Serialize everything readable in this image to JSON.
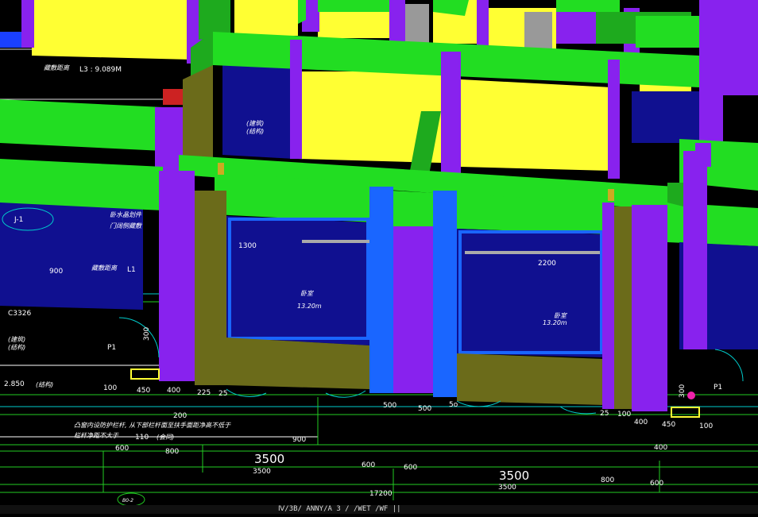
{
  "labels": {
    "hiding_distance_top": "藏敷距离",
    "l3": "L3 : 9.089M",
    "j1": "J-1",
    "water_col": "卧水晶划件",
    "door_window": "门阔侧藏敷",
    "hiding_distance_l1": "藏敷距离",
    "l1": "L1",
    "v900_left": "900",
    "c3326": "C3326",
    "jianzhu": "(建筑)",
    "jiegou": "(结构)",
    "jianzhu2": "(建筑)",
    "jiegou2": "(结构)",
    "p1_left": "P1",
    "p1_right": "P1",
    "bedroom_left": "卧室",
    "area_left": "13.20m",
    "bedroom_right": "卧室",
    "area_right": "13.20m",
    "v1300": "1300",
    "v2200": "2200",
    "v300a": "300",
    "v300b": "300",
    "v2850": "2.850",
    "jiegou3": "(结构)",
    "note1": "凸窗内设防护栏杆, 从下部栏杆面至扶手面距净高不低于",
    "note2": "栏杆净距不大于",
    "v110": "110",
    "huishu": "(会同)",
    "d100a": "100",
    "d450a": "450",
    "d400a": "400",
    "d225a": "225",
    "d25a": "25",
    "d200": "200",
    "d900": "900",
    "d600a": "600",
    "d800a": "800",
    "d3500a": "3500",
    "d3500big1": "3500",
    "d600b": "600",
    "d600c": "600",
    "d3500b": "3500",
    "d3500big2": "3500",
    "d800b": "800",
    "d600d": "600",
    "d17200": "17200",
    "d500a": "500",
    "d500b": "500",
    "d5o": "5o",
    "d25b": "25",
    "d100b": "100",
    "d400b": "400",
    "d450b": "450",
    "d100c": "100",
    "d400c": "400",
    "tag_bottom": "B0-2",
    "status": "Ⅳ/3B/ ANNY/A     3 /     /WET  /WF  ||"
  },
  "colors": {
    "green": "#22dd22",
    "yellow": "#ffff33",
    "purple": "#8822ee",
    "blue": "#1a66ff",
    "navy": "#101090",
    "olive": "#6b6b1a"
  }
}
